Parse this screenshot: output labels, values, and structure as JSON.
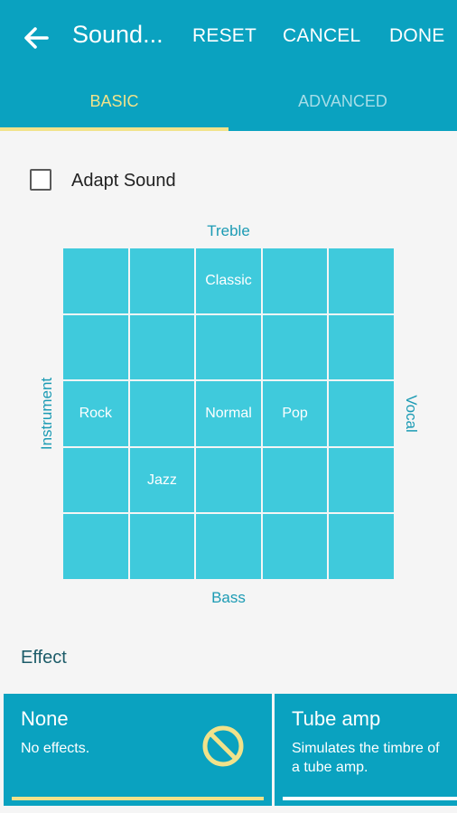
{
  "appbar": {
    "title": "Sound...",
    "actions": {
      "reset": "RESET",
      "cancel": "CANCEL",
      "done": "DONE"
    },
    "icon": "arrow-back-icon",
    "color": "#0aa2c0"
  },
  "tabs": [
    {
      "label": "BASIC",
      "selected": true
    },
    {
      "label": "ADVANCED",
      "selected": false
    }
  ],
  "adapt_sound": {
    "label": "Adapt Sound",
    "checked": false
  },
  "equalizer": {
    "axis": {
      "top": "Treble",
      "bottom": "Bass",
      "left": "Instrument",
      "right": "Vocal"
    },
    "presets": {
      "classic": "Classic",
      "rock": "Rock",
      "normal": "Normal",
      "pop": "Pop",
      "jazz": "Jazz"
    },
    "cell_color": "#3fcadc"
  },
  "effect": {
    "section_label": "Effect",
    "cards": [
      {
        "title": "None",
        "description": "No effects.",
        "icon": "no-effect-icon",
        "selected": true
      },
      {
        "title": "Tube amp",
        "description": "Simulates the timbre of a tube amp.",
        "selected": false
      }
    ]
  },
  "colors": {
    "accent": "#f1e28a",
    "primary": "#0aa2c0"
  }
}
